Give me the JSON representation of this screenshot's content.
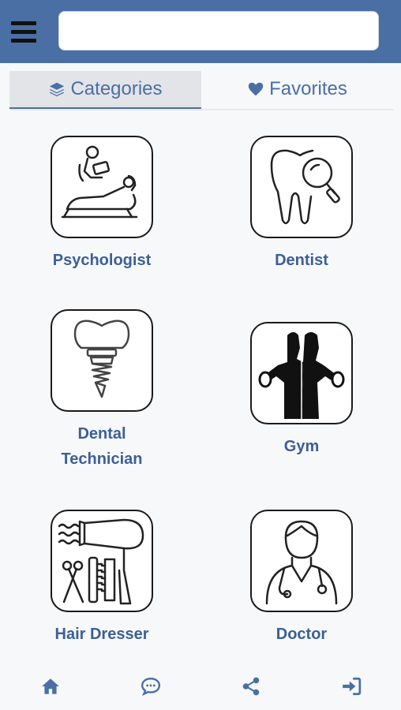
{
  "search": {
    "value": "",
    "placeholder": ""
  },
  "tabs": [
    {
      "label": "Categories",
      "icon": "layers-icon",
      "active": true
    },
    {
      "label": "Favorites",
      "icon": "heart-icon",
      "active": false
    }
  ],
  "categories": [
    {
      "label": "Psychologist",
      "icon": "psychologist-icon"
    },
    {
      "label": "Dentist",
      "icon": "tooth-magnifier-icon"
    },
    {
      "label": "Dental Technician",
      "icon": "dental-implant-icon"
    },
    {
      "label": "Gym",
      "icon": "gym-icon"
    },
    {
      "label": "Hair Dresser",
      "icon": "hair-tools-icon"
    },
    {
      "label": "Doctor",
      "icon": "doctor-icon"
    }
  ],
  "bottom_nav": [
    {
      "name": "home",
      "icon": "home-icon"
    },
    {
      "name": "chat",
      "icon": "chat-icon"
    },
    {
      "name": "share",
      "icon": "share-icon"
    },
    {
      "name": "login",
      "icon": "sign-in-icon"
    }
  ],
  "colors": {
    "accent": "#4a6fa5",
    "label": "#3c5f96",
    "tab_active_bg": "#e2e4e8"
  }
}
